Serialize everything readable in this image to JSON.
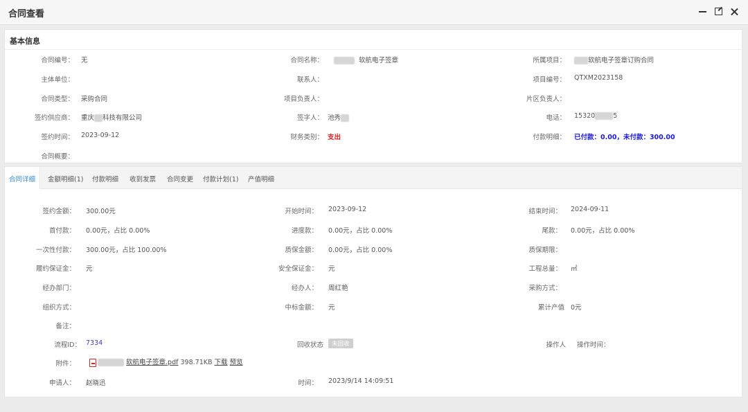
{
  "window": {
    "title": "合同查看"
  },
  "basic": {
    "section_title": "基本信息",
    "fields": {
      "contract_no": {
        "label": "合同编号：",
        "value": "无"
      },
      "contract_name": {
        "label": "合同名称：",
        "value": "软航电子签章"
      },
      "project": {
        "label": "所属项目：",
        "value": "软航电子签章订购合同"
      },
      "main_unit": {
        "label": "主体单位：",
        "value": ""
      },
      "contact": {
        "label": "联系人：",
        "value": ""
      },
      "project_no": {
        "label": "项目编号：",
        "value": "QTXM2023158"
      },
      "contract_type": {
        "label": "合同类型：",
        "value": "采购合同"
      },
      "project_manager": {
        "label": "项目负责人：",
        "value": ""
      },
      "area_manager": {
        "label": "片区负责人：",
        "value": ""
      },
      "supplier": {
        "label": "签约供应商：",
        "value_prefix": "重庆",
        "value_suffix": "科技有限公司"
      },
      "signer": {
        "label": "签字人：",
        "value": "池秀"
      },
      "phone": {
        "label": "电话：",
        "value_prefix": "15320",
        "value_suffix": "5"
      },
      "sign_date": {
        "label": "签约时间：",
        "value": "2023-09-12"
      },
      "finance_type": {
        "label": "财务类别：",
        "value": "支出"
      },
      "payment_detail": {
        "label": "付款明细：",
        "value": "已付款：0.00，未付款：300.00"
      },
      "summary": {
        "label": "合同概要：",
        "value": ""
      }
    }
  },
  "tabs": [
    {
      "label": "合同详细",
      "active": true
    },
    {
      "label": "金额明细(1)"
    },
    {
      "label": "付款明细"
    },
    {
      "label": "收到发票"
    },
    {
      "label": "合同变更"
    },
    {
      "label": "付款计划(1)"
    },
    {
      "label": "产值明细"
    }
  ],
  "detail": {
    "fields": {
      "sign_amount": {
        "label": "签约金额：",
        "value": "300.00元"
      },
      "start_date": {
        "label": "开始时间：",
        "value": "2023-09-12"
      },
      "end_date": {
        "label": "结束时间：",
        "value": "2024-09-11"
      },
      "first_payment": {
        "label": "首付款：",
        "value": "0.00元，占比 0.00%"
      },
      "progress_payment": {
        "label": "进度款：",
        "value": "0.00元，占比 0.00%"
      },
      "final_payment": {
        "label": "尾款：",
        "value": "0.00元，占比 0.00%"
      },
      "lump_payment": {
        "label": "一次性付款：",
        "value": "300.00元，占比 100.00%"
      },
      "warranty_amount": {
        "label": "质保金额：",
        "value": "0.00元，占比 0.00%"
      },
      "warranty_period": {
        "label": "质保期限：",
        "value": ""
      },
      "performance_bond": {
        "label": "履约保证金：",
        "value": "元"
      },
      "safety_bond": {
        "label": "安全保证金：",
        "value": "元"
      },
      "total_quantity": {
        "label": "工程总量：",
        "value": "㎡"
      },
      "department": {
        "label": "经办部门：",
        "value": ""
      },
      "handler": {
        "label": "经办人：",
        "value": "周红艳"
      },
      "purchase_method": {
        "label": "采购方式：",
        "value": ""
      },
      "organization": {
        "label": "组织方式：",
        "value": ""
      },
      "bid_amount": {
        "label": "中标金额：",
        "value": "元"
      },
      "cumulative_output": {
        "label": "累计产值",
        "value": "0元"
      },
      "remark": {
        "label": "备注：",
        "value": ""
      },
      "process_id": {
        "label": "流程ID：",
        "value": "7334"
      },
      "recovery_status": {
        "label": "回收状态",
        "value": "未回收"
      },
      "operator": {
        "label": "操作人",
        "value": ""
      },
      "operate_time": {
        "label": "操作时间：",
        "value": ""
      },
      "attachment": {
        "label": "附件：",
        "filename": "软航电子签章.pdf",
        "size": "398.71KB",
        "download": "下载",
        "preview": "预览"
      },
      "applicant": {
        "label": "申请人：",
        "value": "赵晓迅"
      },
      "time": {
        "label": "时间：",
        "value": "2023/9/14 14:09:51"
      }
    }
  }
}
